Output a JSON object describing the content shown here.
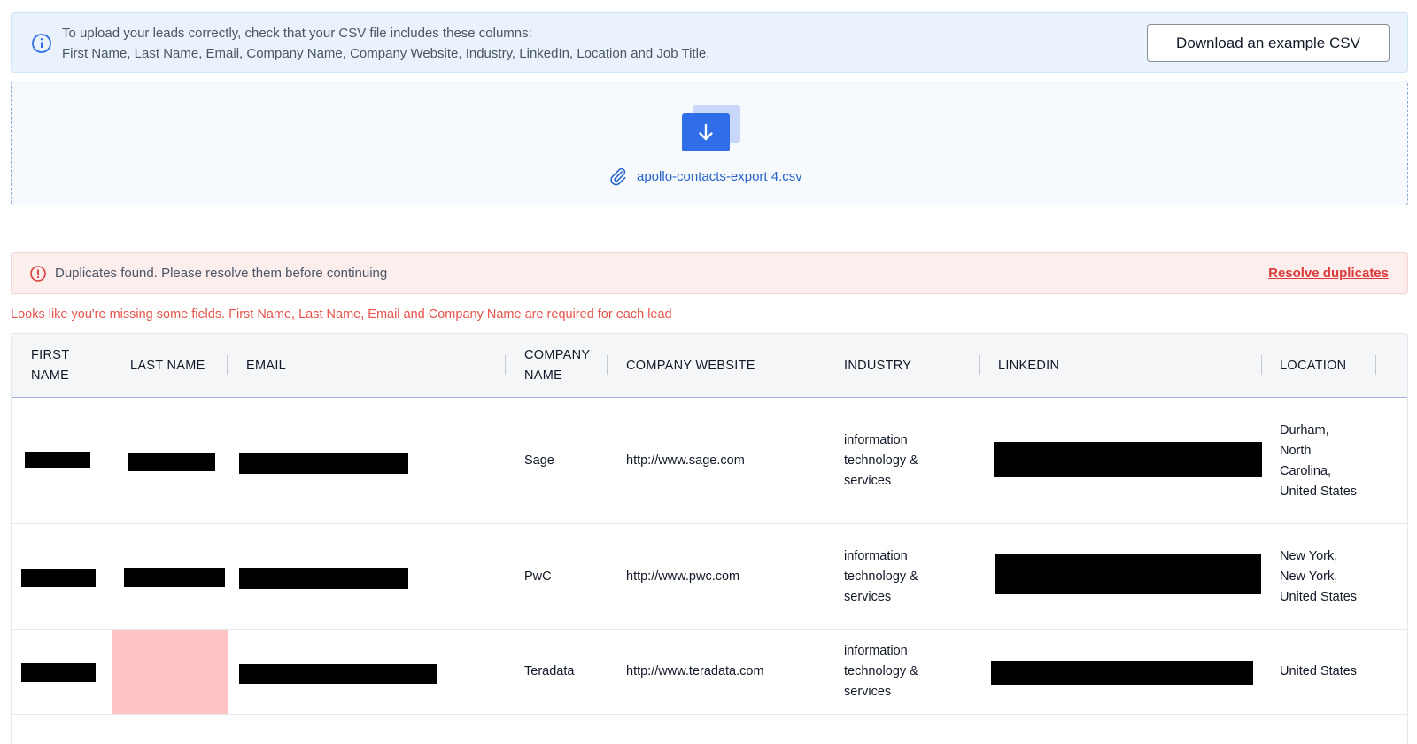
{
  "info_banner": {
    "line1": "To upload your leads correctly, check that your CSV file includes these columns:",
    "line2": "First Name, Last Name, Email, Company Name, Company Website, Industry, LinkedIn, Location and Job Title.",
    "download_label": "Download an example CSV",
    "icon": "info-circle-icon"
  },
  "dropzone": {
    "file_name": "apollo-contacts-export 4.csv",
    "icons": [
      "upload-icon",
      "paperclip-icon"
    ]
  },
  "duplicates_alert": {
    "message": "Duplicates found. Please resolve them before continuing",
    "action_label": "Resolve duplicates",
    "icon": "alert-circle-icon"
  },
  "missing_fields_message": "Looks like you're missing some fields. First Name, Last Name, Email and Company Name are required for each lead",
  "table": {
    "headers": {
      "first_name": "FIRST NAME",
      "last_name": "LAST NAME",
      "email": "EMAIL",
      "company_name": "COMPANY NAME",
      "company_website": "COMPANY WEBSITE",
      "industry": "INDUSTRY",
      "linkedin": "LINKEDIN",
      "location": "LOCATION"
    },
    "rows": [
      {
        "company_name": "Sage",
        "company_website": "http://www.sage.com",
        "industry": "information technology & services",
        "location": "Durham, North Carolina, United States"
      },
      {
        "company_name": "PwC",
        "company_website": "http://www.pwc.com",
        "industry": "information technology & services",
        "location": "New York, New York, United States"
      },
      {
        "company_name": "Teradata",
        "company_website": "http://www.teradata.com",
        "industry": "information technology & services",
        "location": "United States"
      }
    ]
  },
  "colors": {
    "accent_blue": "#2f6ee8",
    "error_red": "#dc3b3b",
    "missing_cell": "#fec4c4"
  }
}
